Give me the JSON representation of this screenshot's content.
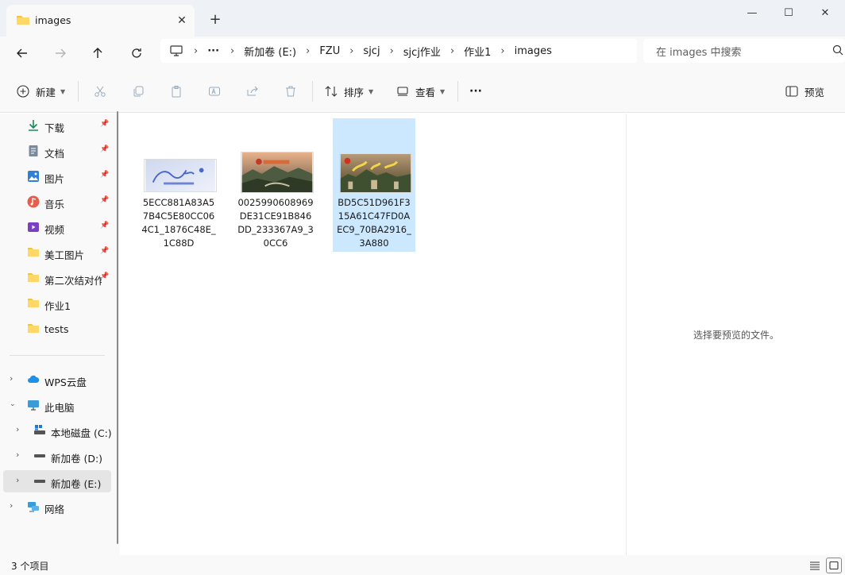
{
  "tab": {
    "title": "images",
    "close": "✕",
    "new": "+"
  },
  "window": {
    "minimize": "—",
    "maximize": "☐",
    "close": "✕"
  },
  "nav": {
    "more": "···"
  },
  "breadcrumbs": [
    "新加卷 (E:)",
    "FZU",
    "sjcj",
    "sjcj作业",
    "作业1",
    "images"
  ],
  "search": {
    "placeholder": "在 images 中搜索"
  },
  "toolbar": {
    "new_label": "新建",
    "sort_label": "排序",
    "view_label": "查看",
    "more_label": "···",
    "preview_label": "预览"
  },
  "sidebar": {
    "quick_access": [
      {
        "label": "下载",
        "icon": "download-icon"
      },
      {
        "label": "文档",
        "icon": "document-icon"
      },
      {
        "label": "图片",
        "icon": "pictures-icon"
      },
      {
        "label": "音乐",
        "icon": "music-icon"
      },
      {
        "label": "视频",
        "icon": "video-icon"
      },
      {
        "label": "美工图片",
        "icon": "folder-icon"
      },
      {
        "label": "第二次结对作业",
        "icon": "folder-icon"
      },
      {
        "label": "作业1",
        "icon": "folder-icon"
      },
      {
        "label": "tests",
        "icon": "folder-icon"
      }
    ],
    "tree": [
      {
        "label": "WPS云盘",
        "icon": "cloud-icon"
      },
      {
        "label": "此电脑",
        "icon": "computer-icon"
      },
      {
        "label": "本地磁盘 (C:)",
        "icon": "drive-icon"
      },
      {
        "label": "新加卷 (D:)",
        "icon": "drive-icon"
      },
      {
        "label": "新加卷 (E:)",
        "icon": "drive-icon"
      },
      {
        "label": "网络",
        "icon": "network-icon"
      }
    ]
  },
  "files": [
    {
      "name": "5ECC881A83A57B4C5E80CC064C1_1876C48E_1C88D"
    },
    {
      "name": "0025990608969DE31CE91B846DD_233367A9_30CC6"
    },
    {
      "name": "BD5C51D961F315A61C47FD0AEC9_70BA2916_3A880"
    }
  ],
  "preview": {
    "message": "选择要预览的文件。"
  },
  "status": {
    "count": "3 个项目"
  },
  "colors": {
    "selected": "#cce8ff",
    "folder": "#f6c23e",
    "accent": "#0067c0"
  }
}
